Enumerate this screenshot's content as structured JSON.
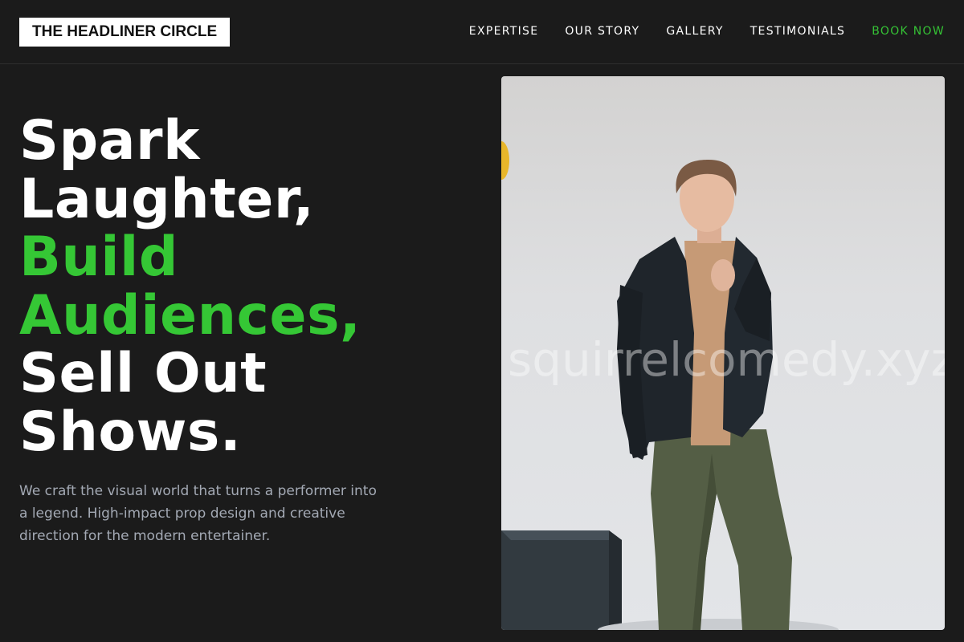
{
  "header": {
    "logo": "THE HEADLINER CIRCLE",
    "nav": [
      {
        "label": "EXPERTISE"
      },
      {
        "label": "OUR STORY"
      },
      {
        "label": "GALLERY"
      },
      {
        "label": "TESTIMONIALS"
      },
      {
        "label": "BOOK NOW",
        "highlight": true
      }
    ]
  },
  "hero": {
    "title_lines": [
      "Spark",
      "Laughter,",
      "Build",
      "Audiences,",
      "Sell Out",
      "Shows."
    ],
    "description": "We craft the visual world that turns a performer into a legend. High-impact prop design and creative direction for the modern entertainer."
  },
  "image": {
    "watermark": "squirrelcomedy.xyz",
    "subject": "man in dark blazer and green trousers standing beside a dark cube"
  },
  "colors": {
    "background": "#1b1b1b",
    "accent": "#35c735",
    "text": "#ffffff",
    "muted_text": "#a3a9b4"
  }
}
